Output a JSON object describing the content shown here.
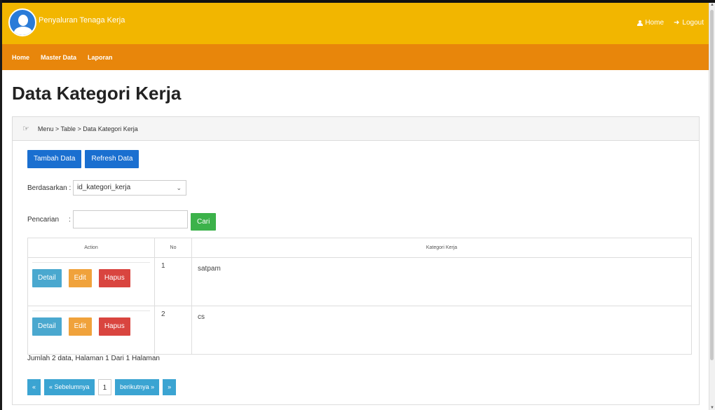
{
  "header": {
    "app_title": "Penyaluran Tenaga Kerja",
    "home_label": "Home",
    "logout_label": "Logout",
    "brand_color": "#f2b600"
  },
  "nav": {
    "items": [
      "Home",
      "Master Data",
      "Laporan"
    ],
    "color": "#e8860b"
  },
  "page": {
    "title": "Data Kategori Kerja",
    "breadcrumb": "Menu > Table > Data Kategori Kerja"
  },
  "toolbar": {
    "add_label": "Tambah Data",
    "refresh_label": "Refresh Data"
  },
  "filter": {
    "by_label": "Berdasarkan :",
    "by_value": "id_kategori_kerja",
    "search_label": "Pencarian",
    "search_sep": ":",
    "search_value": "",
    "search_button": "Cari"
  },
  "table": {
    "columns": [
      "Action",
      "No",
      "Kategori Kerja"
    ],
    "action_labels": {
      "detail": "Detail",
      "edit": "Edit",
      "delete": "Hapus"
    },
    "rows": [
      {
        "no": "1",
        "kategori": "satpam"
      },
      {
        "no": "2",
        "kategori": "cs"
      }
    ]
  },
  "summary": "Jumlah 2 data, Halaman 1 Dari 1 Halaman",
  "pagination": {
    "first": "«",
    "prev": "« Sebelumnya",
    "current": "1",
    "next": "berikutnya »",
    "last": "»"
  }
}
